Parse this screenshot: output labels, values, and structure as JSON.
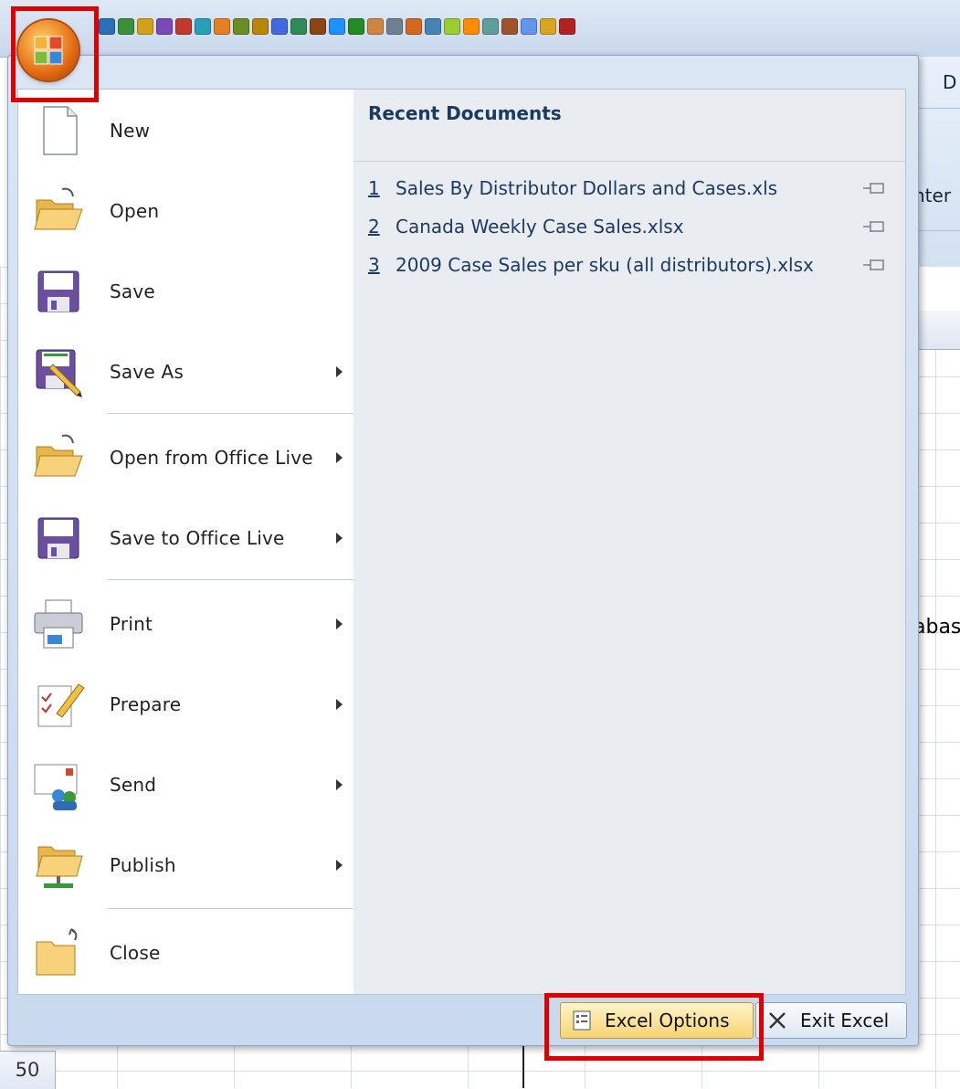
{
  "quick_access_toolbar": {
    "icon_colors": [
      "#2a6fb8",
      "#3a8f3a",
      "#d4a017",
      "#7a4ab8",
      "#c0392b",
      "#2a9fb8",
      "#e67e22",
      "#6b8e23",
      "#b8860b",
      "#4169e1",
      "#2e8b57",
      "#8b4513",
      "#1e90ff",
      "#228b22",
      "#cd853f",
      "#708090",
      "#d2691e",
      "#4682b4",
      "#9acd32",
      "#ff8c00",
      "#5f9ea0",
      "#a0522d",
      "#6495ed",
      "#daa520",
      "#b22222"
    ]
  },
  "ribbon": {
    "partial_tab": "D",
    "partial_group": "nter",
    "partial_cell": "abas"
  },
  "office_menu": {
    "left_items": [
      {
        "label": "New",
        "icon": "new-document-icon",
        "has_arrow": false
      },
      {
        "label": "Open",
        "icon": "open-folder-icon",
        "has_arrow": false
      },
      {
        "label": "Save",
        "icon": "save-disk-icon",
        "has_arrow": false
      },
      {
        "label": "Save As",
        "icon": "save-as-icon",
        "has_arrow": true
      },
      {
        "label": "Open from Office Live",
        "icon": "open-folder-icon",
        "has_arrow": true
      },
      {
        "label": "Save to Office Live",
        "icon": "save-disk-icon",
        "has_arrow": true
      },
      {
        "label": "Print",
        "icon": "printer-icon",
        "has_arrow": true
      },
      {
        "label": "Prepare",
        "icon": "prepare-pen-icon",
        "has_arrow": true
      },
      {
        "label": "Send",
        "icon": "send-mail-icon",
        "has_arrow": true
      },
      {
        "label": "Publish",
        "icon": "publish-folder-icon",
        "has_arrow": true
      },
      {
        "label": "Close",
        "icon": "close-folder-icon",
        "has_arrow": false
      }
    ],
    "recent": {
      "title": "Recent Documents",
      "documents": [
        {
          "num": "1",
          "name": "Sales By Distributor Dollars and Cases.xls"
        },
        {
          "num": "2",
          "name": "Canada Weekly Case Sales.xlsx"
        },
        {
          "num": "3",
          "name": "2009 Case Sales per sku (all distributors).xlsx"
        }
      ]
    },
    "footer": {
      "options_label": "Excel Options",
      "exit_label": "Exit Excel"
    }
  },
  "sheet": {
    "row_number": "50"
  },
  "colors": {
    "highlight": "#e00000",
    "menu_text": "#1b3a63"
  }
}
